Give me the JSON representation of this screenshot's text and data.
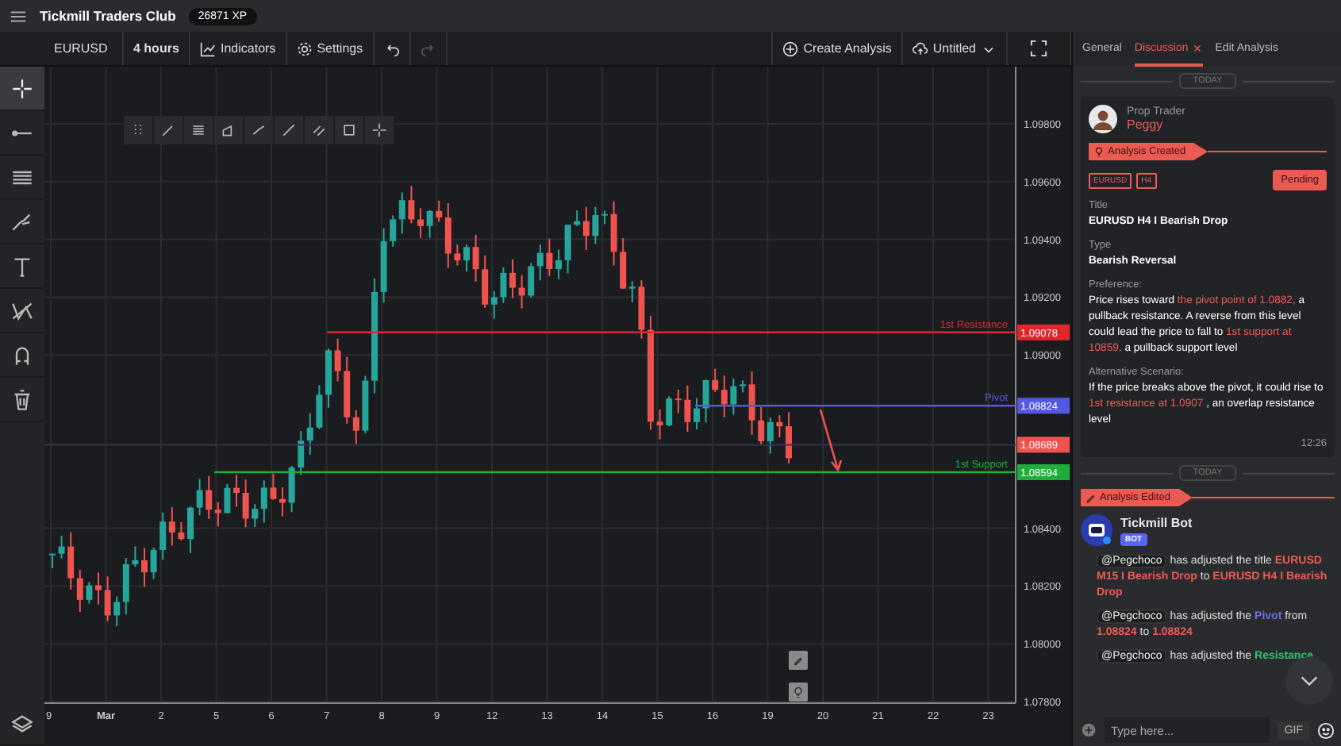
{
  "header": {
    "title": "Tickmill Traders Club",
    "xp": "26871 XP"
  },
  "toolbar": {
    "symbol": "EURUSD",
    "interval": "4 hours",
    "indicators": "Indicators",
    "settings": "Settings",
    "undo": {
      "disabled": false
    },
    "redo": {
      "disabled": true
    },
    "create": "Create Analysis",
    "layout": "Untitled"
  },
  "tools": [
    {
      "selected": true
    },
    {
      "selected": false
    },
    {
      "selected": false
    },
    {
      "selected": false
    },
    {
      "selected": false
    },
    {
      "selected": false
    },
    {
      "selected": false
    },
    {
      "selected": false
    }
  ],
  "chart": {
    "price_labels": [
      "1.09800",
      "1.09600",
      "1.09400",
      "1.09200",
      "1.09000",
      "1.08400",
      "1.08200",
      "1.08000",
      "1.07800"
    ],
    "time_labels": [
      {
        "label": "9",
        "kind": "day"
      },
      {
        "label": "Mar",
        "kind": "month"
      },
      {
        "label": "2",
        "kind": "day"
      },
      {
        "label": "5",
        "kind": "day"
      },
      {
        "label": "6",
        "kind": "day"
      },
      {
        "label": "7",
        "kind": "day"
      },
      {
        "label": "8",
        "kind": "day"
      },
      {
        "label": "9",
        "kind": "day"
      },
      {
        "label": "12",
        "kind": "day"
      },
      {
        "label": "13",
        "kind": "day"
      },
      {
        "label": "14",
        "kind": "day"
      },
      {
        "label": "15",
        "kind": "day"
      },
      {
        "label": "16",
        "kind": "day"
      },
      {
        "label": "19",
        "kind": "day"
      },
      {
        "label": "20",
        "kind": "day"
      },
      {
        "label": "21",
        "kind": "day"
      },
      {
        "label": "22",
        "kind": "day"
      },
      {
        "label": "23",
        "kind": "day"
      }
    ],
    "levels": [
      {
        "label": "1st Resistance",
        "price": "1.09078",
        "color": "#e0262b"
      },
      {
        "label": "Pivot",
        "price": "1.08824",
        "color": "#5458e0"
      },
      {
        "label": "1st Support",
        "price": "1.08594",
        "color": "#1fae3a"
      }
    ],
    "current_price": "1.08689"
  },
  "panel": {
    "tabs": [
      {
        "label": "General",
        "selected": false
      },
      {
        "label": "Discussion",
        "selected": true
      },
      {
        "label": "Edit Analysis",
        "selected": false
      }
    ],
    "analysis": {
      "divider": "TODAY",
      "role": "Prop Trader",
      "author": "Peggy",
      "event": "Analysis Created",
      "tags": [
        "EURUSD",
        "H4"
      ],
      "status": "Pending",
      "fields": [
        {
          "label": "Title",
          "kind": "strong",
          "value": [
            {
              "text": "EURUSD H4 I Bearish Drop",
              "kind": "plain"
            }
          ]
        },
        {
          "label": "Type",
          "kind": "strong",
          "value": [
            {
              "text": "Bearish Reversal",
              "kind": "plain"
            }
          ]
        },
        {
          "label": "Preference:",
          "kind": "text",
          "value": [
            {
              "text": "Price rises toward",
              "kind": "plain"
            },
            {
              "text": "the pivot point of 1.0882,",
              "kind": "highlight"
            },
            {
              "text": "a pullback resistance. A reverse from this level could lead the price to fall to",
              "kind": "plain"
            },
            {
              "text": "1st support at 10859,",
              "kind": "highlight"
            },
            {
              "text": "a pullback support level",
              "kind": "plain"
            }
          ]
        },
        {
          "label": "Alternative Scenario:",
          "kind": "text",
          "value": [
            {
              "text": "If the price breaks above the pivot, it could rise to",
              "kind": "plain"
            },
            {
              "text": "1st resistance at 1.0907",
              "kind": "highlight"
            },
            {
              "text": ", an overlap resistance level",
              "kind": "plain"
            }
          ]
        }
      ],
      "time": "12:26"
    },
    "edit": {
      "divider": "TODAY",
      "event": "Analysis Edited",
      "bot": "Tickmill Bot",
      "badge": "BOT",
      "messages": [
        {
          "mention": "@Pegchoco",
          "segments": [
            {
              "text": "has adjusted the title",
              "kind": "plain"
            },
            {
              "text": "EURUSD M15 I Bearish Drop",
              "kind": "highlight"
            },
            {
              "text": "to",
              "kind": "plain"
            },
            {
              "text": "EURUSD H4 I Bearish Drop",
              "kind": "highlight"
            }
          ]
        },
        {
          "mention": "@Pegchoco",
          "segments": [
            {
              "text": "has adjusted the",
              "kind": "plain"
            },
            {
              "text": "Pivot",
              "kind": "pivot"
            },
            {
              "text": "from",
              "kind": "plain"
            },
            {
              "text": "1.08824",
              "kind": "highlight"
            },
            {
              "text": "to",
              "kind": "plain"
            },
            {
              "text": "1.08824",
              "kind": "highlight"
            }
          ]
        },
        {
          "mention": "@Pegchoco",
          "segments": [
            {
              "text": "has adjusted the",
              "kind": "plain"
            },
            {
              "text": "Resistance",
              "kind": "resistance"
            }
          ]
        }
      ]
    },
    "composer": {
      "placeholder": "Type here...",
      "gif": "GIF"
    }
  }
}
